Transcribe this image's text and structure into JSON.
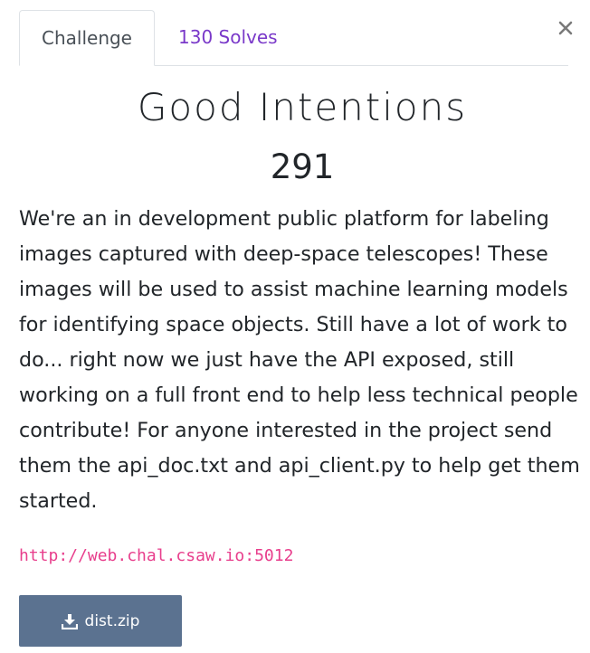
{
  "modal": {
    "close_label": "×"
  },
  "tabs": [
    {
      "label": "Challenge",
      "active": true
    },
    {
      "label": "130 Solves",
      "active": false
    }
  ],
  "challenge": {
    "name": "Good Intentions",
    "points": "291",
    "description": "We're an in development public platform for labeling images captured with deep-space telescopes! These images will be used to assist machine learning models for identifying space objects. Still have a lot of work to do... right now we just have the API exposed, still working on a full front end to help less technical people contribute! For anyone interested in the project send them the api_doc.txt and api_client.py to help get them started.",
    "url": "http://web.chal.csaw.io:5012",
    "file_label": "dist.zip",
    "file_icon": "download-icon"
  },
  "colors": {
    "solves_link": "#7a39c9",
    "url_text": "#e83e8c",
    "download_button": "#5b7290"
  }
}
